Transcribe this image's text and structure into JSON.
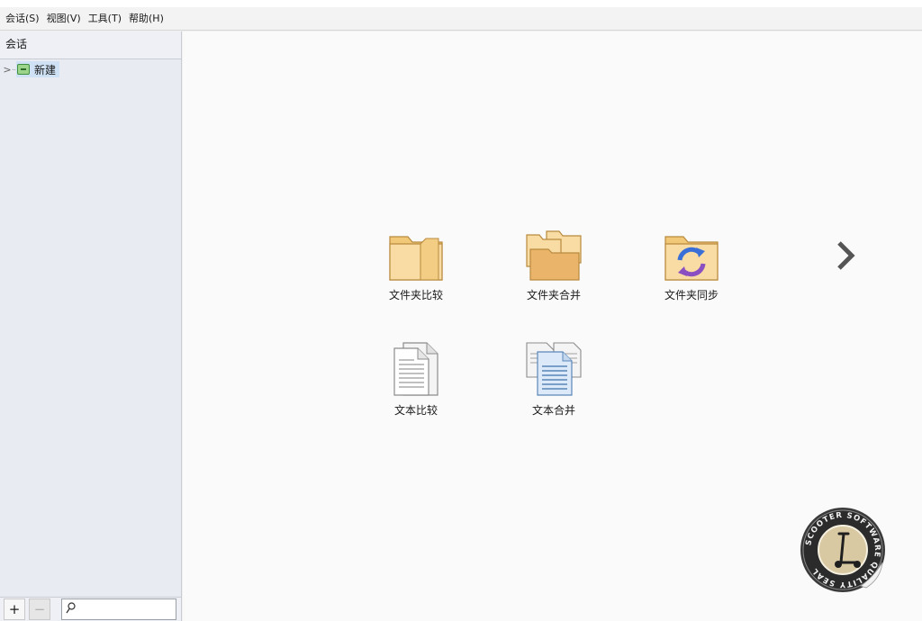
{
  "menubar": {
    "items": [
      "会话(S)",
      "视图(V)",
      "工具(T)",
      "帮助(H)"
    ]
  },
  "sidebar": {
    "header": "会话",
    "tree": [
      {
        "label": "新建",
        "expander": ">",
        "icon": "session-folder-icon"
      }
    ],
    "footer": {
      "add_label": "+",
      "remove_label": "−",
      "search_placeholder": ""
    }
  },
  "main": {
    "tiles": [
      {
        "label": "文件夹比较",
        "icon": "folder-compare-icon"
      },
      {
        "label": "文件夹合并",
        "icon": "folder-merge-icon"
      },
      {
        "label": "文件夹同步",
        "icon": "folder-sync-icon"
      },
      {
        "label": "文本比较",
        "icon": "text-compare-icon"
      },
      {
        "label": "文本合并",
        "icon": "text-merge-icon"
      }
    ],
    "next_icon": "chevron-right-icon",
    "seal_text": "SCOOTER SOFTWARE QUALITY SEAL"
  },
  "colors": {
    "folder_fill": "#f6d79a",
    "folder_stroke": "#b98a3e",
    "sync_arrow_blue": "#3b6fd8",
    "sync_arrow_purple": "#8a4fc0",
    "selection": "#cfe2f5"
  }
}
